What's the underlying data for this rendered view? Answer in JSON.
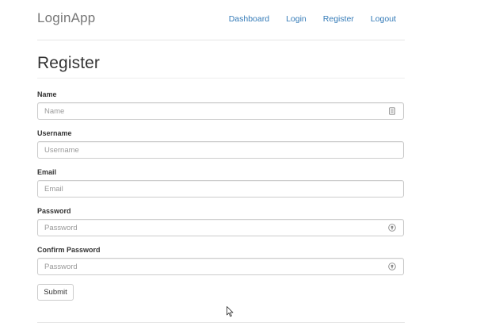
{
  "header": {
    "brand": "LoginApp",
    "nav": [
      "Dashboard",
      "Login",
      "Register",
      "Logout"
    ]
  },
  "page": {
    "title": "Register"
  },
  "form": {
    "name": {
      "label": "Name",
      "placeholder": "Name",
      "value": "",
      "icon": "contact-card-icon"
    },
    "username": {
      "label": "Username",
      "placeholder": "Username",
      "value": ""
    },
    "email": {
      "label": "Email",
      "placeholder": "Email",
      "value": ""
    },
    "password": {
      "label": "Password",
      "placeholder": "Password",
      "value": "",
      "icon": "password-manager-icon"
    },
    "confirm_password": {
      "label": "Confirm Password",
      "placeholder": "Password",
      "value": "",
      "icon": "password-manager-icon"
    },
    "submit_label": "Submit"
  },
  "colors": {
    "link": "#337ab7",
    "brand": "#777777",
    "border": "#cccccc"
  }
}
